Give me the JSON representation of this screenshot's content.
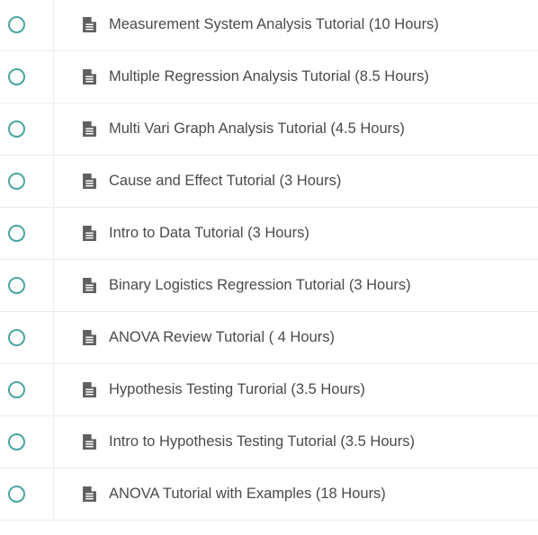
{
  "colors": {
    "accent": "#4aa3a3",
    "text": "#4a4a4a",
    "icon": "#5f5f5f"
  },
  "lectures": [
    {
      "title": "Measurement System Analysis Tutorial (10 Hours)",
      "icon": "file-text-icon",
      "completed": false
    },
    {
      "title": "Multiple Regression Analysis Tutorial (8.5 Hours)",
      "icon": "file-text-icon",
      "completed": false
    },
    {
      "title": "Multi Vari Graph Analysis Tutorial (4.5 Hours)",
      "icon": "file-text-icon",
      "completed": false
    },
    {
      "title": "Cause and Effect Tutorial (3 Hours)",
      "icon": "file-text-icon",
      "completed": false
    },
    {
      "title": "Intro to Data Tutorial (3 Hours)",
      "icon": "file-text-icon",
      "completed": false
    },
    {
      "title": "Binary Logistics Regression Tutorial (3 Hours)",
      "icon": "file-text-icon",
      "completed": false
    },
    {
      "title": "ANOVA Review Tutorial ( 4 Hours)",
      "icon": "file-text-icon",
      "completed": false
    },
    {
      "title": "Hypothesis Testing Turorial (3.5 Hours)",
      "icon": "file-text-icon",
      "completed": false
    },
    {
      "title": "Intro to Hypothesis Testing Tutorial (3.5 Hours)",
      "icon": "file-text-icon",
      "completed": false
    },
    {
      "title": "ANOVA Tutorial with Examples (18 Hours)",
      "icon": "file-text-icon",
      "completed": false
    }
  ]
}
